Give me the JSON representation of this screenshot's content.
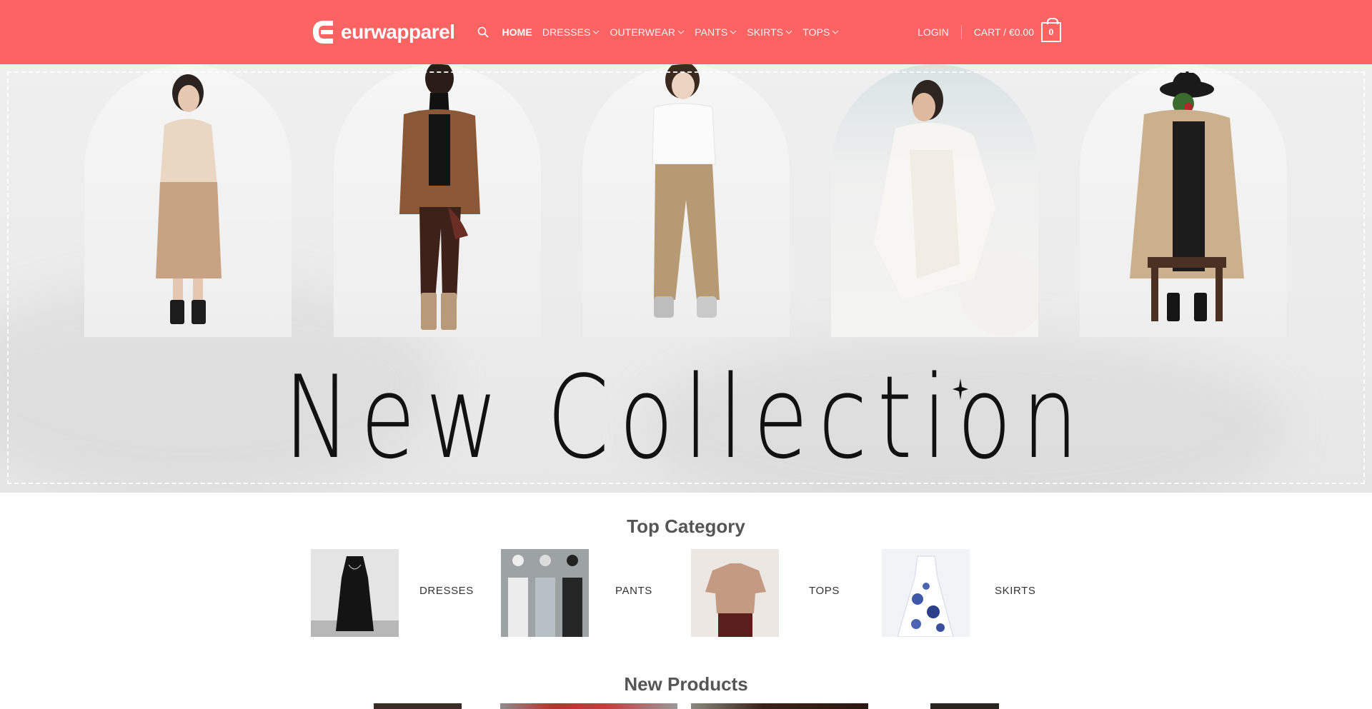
{
  "header": {
    "logo_text": "eurwapparel",
    "logo_icon": "eurwapparel-logo-mark",
    "search_icon": "search-icon",
    "nav": [
      {
        "label": "HOME",
        "active": true,
        "dropdown": false
      },
      {
        "label": "DRESSES",
        "active": false,
        "dropdown": true
      },
      {
        "label": "OUTERWEAR",
        "active": false,
        "dropdown": true
      },
      {
        "label": "PANTS",
        "active": false,
        "dropdown": true
      },
      {
        "label": "SKIRTS",
        "active": false,
        "dropdown": true
      },
      {
        "label": "TOPS",
        "active": false,
        "dropdown": true
      }
    ],
    "login_label": "LOGIN",
    "cart_label": "CART / €0.00",
    "cart_count": "0",
    "accent_color": "#fe6363"
  },
  "hero": {
    "title": "New Collection",
    "images": [
      "model-knit-sweater-skirt",
      "model-brown-leather-outfit",
      "model-white-tee-cargo-pants",
      "model-white-sheer-dress",
      "model-trench-coat-on-chair"
    ]
  },
  "top_category": {
    "title": "Top Category",
    "items": [
      {
        "label": "DRESSES",
        "image": "black-dress-thumbnail"
      },
      {
        "label": "PANTS",
        "image": "wide-leg-pants-thumbnail"
      },
      {
        "label": "TOPS",
        "image": "knit-top-thumbnail"
      },
      {
        "label": "SKIRTS",
        "image": "floral-skirt-thumbnail"
      }
    ]
  },
  "new_products": {
    "title": "New Products"
  }
}
